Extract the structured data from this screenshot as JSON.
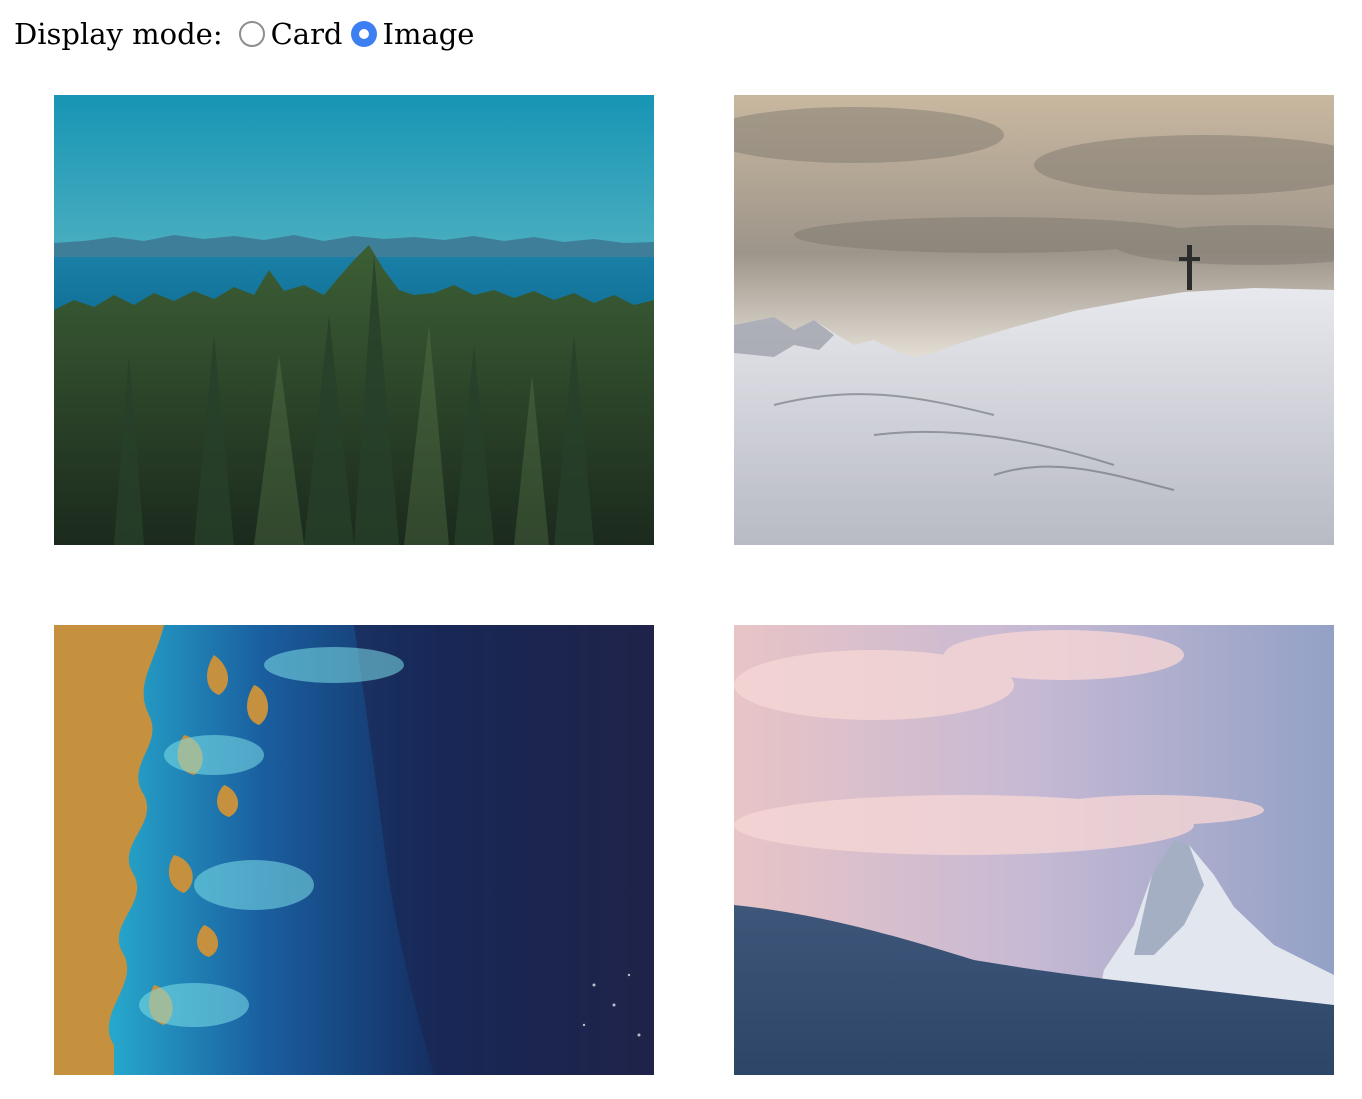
{
  "display_mode": {
    "label": "Display mode:",
    "options": [
      {
        "label": "Card",
        "checked": false
      },
      {
        "label": "Image",
        "checked": true
      }
    ],
    "accent_color": "#3b7ff2"
  },
  "gallery": {
    "images": [
      {
        "subject": "forest and sea with distant mountains"
      },
      {
        "subject": "snowy summit with cross under clouds"
      },
      {
        "subject": "aerial view of coastline and turquoise sea"
      },
      {
        "subject": "snow peak under pink sky"
      }
    ]
  }
}
